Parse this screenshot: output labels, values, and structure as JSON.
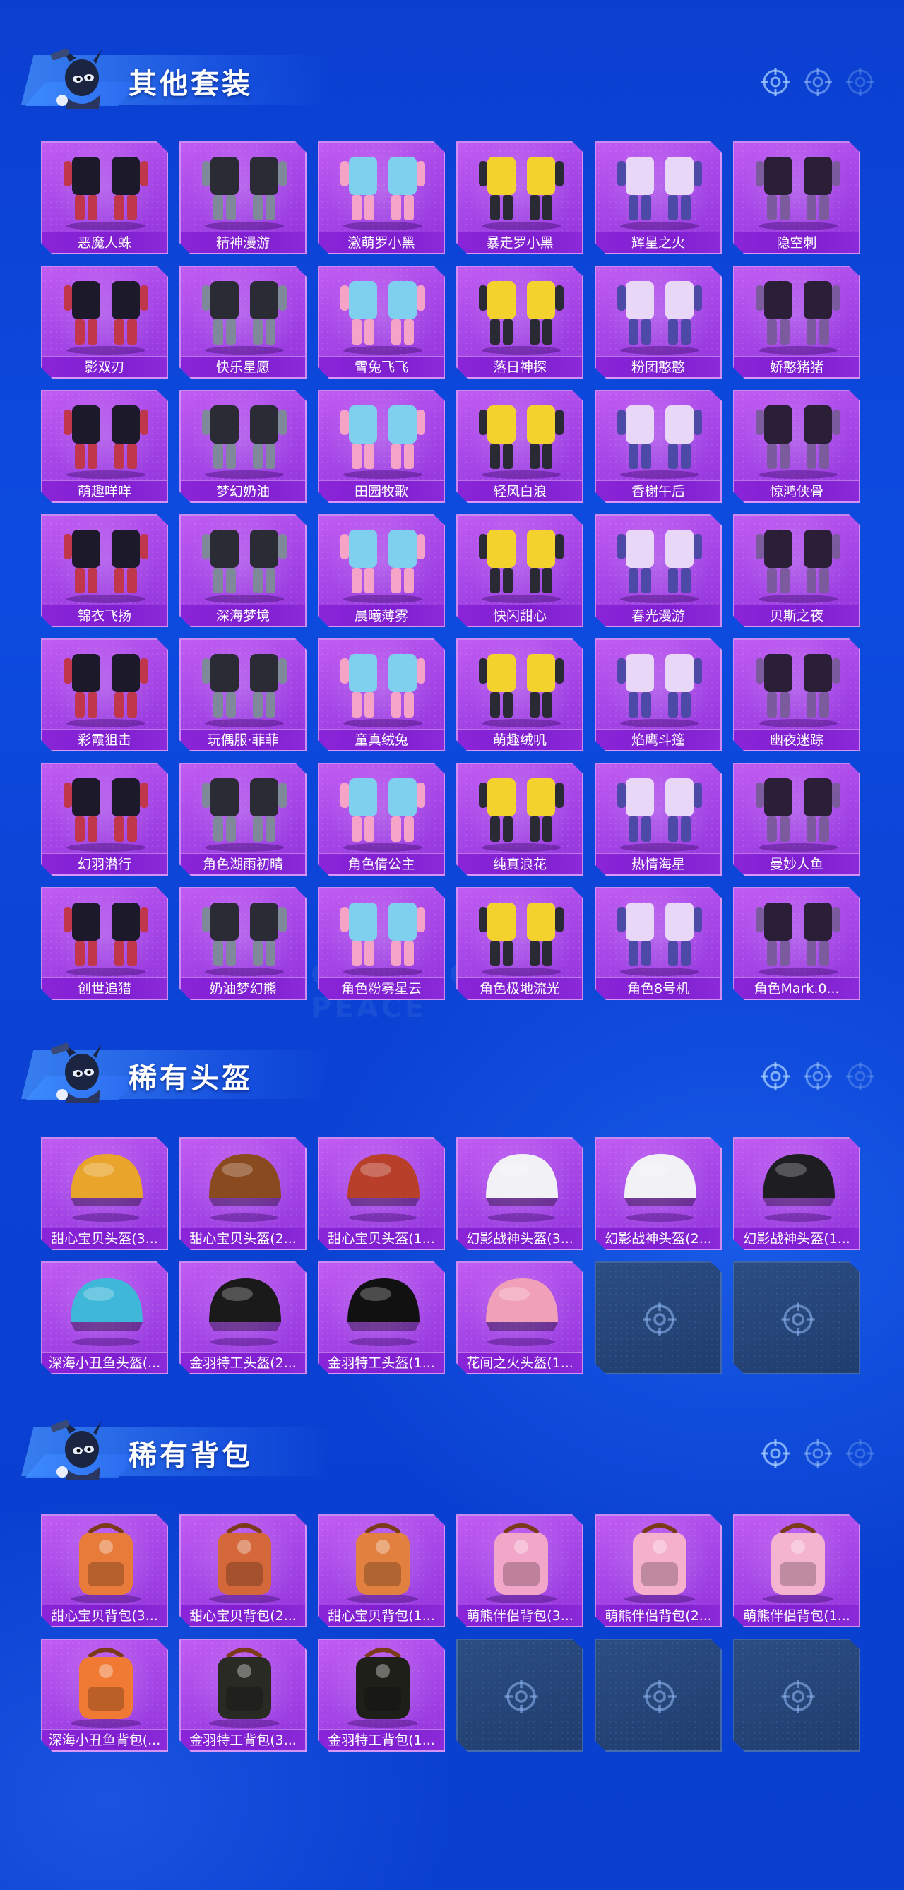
{
  "page": {
    "watermark": "GAME FOR PEACE"
  },
  "colors": {
    "background": "#0d4be0",
    "card_purple": "#a747e8",
    "label_bar": "#8a24d8",
    "empty_slot": "#2b4d82"
  },
  "sections": [
    {
      "title": "其他套装",
      "icon": "target-icon",
      "items": [
        "恶魔人蛛",
        "精神漫游",
        "激萌罗小黑",
        "暴走罗小黑",
        "辉星之火",
        "隐空刺",
        "影双刃",
        "快乐星愿",
        "雪兔飞飞",
        "落日神探",
        "粉团憨憨",
        "娇憨猪猪",
        "萌趣咩咩",
        "梦幻奶油",
        "田园牧歌",
        "轻风白浪",
        "香榭午后",
        "惊鸿侠骨",
        "锦衣飞扬",
        "深海梦境",
        "晨曦薄雾",
        "快闪甜心",
        "春光漫游",
        "贝斯之夜",
        "彩霞狙击",
        "玩偶服·菲菲",
        "童真绒兔",
        "萌趣绒叽",
        "焰鹰斗篷",
        "幽夜迷踪",
        "幻羽潜行",
        "角色湖雨初晴",
        "角色倩公主",
        "纯真浪花",
        "热情海星",
        "曼妙人鱼",
        "创世追猎",
        "奶油梦幻熊",
        "角色粉雾星云",
        "角色极地流光",
        "角色8号机",
        "角色Mark.0..."
      ],
      "empty_slots": 0
    },
    {
      "title": "稀有头盔",
      "icon": "target-icon",
      "items": [
        "甜心宝贝头盔(3...",
        "甜心宝贝头盔(2...",
        "甜心宝贝头盔(1...",
        "幻影战神头盔(3...",
        "幻影战神头盔(2...",
        "幻影战神头盔(1...",
        "深海小丑鱼头盔(...",
        "金羽特工头盔(2...",
        "金羽特工头盔(1...",
        "花间之火头盔(1..."
      ],
      "empty_slots": 2
    },
    {
      "title": "稀有背包",
      "icon": "target-icon",
      "items": [
        "甜心宝贝背包(3...",
        "甜心宝贝背包(2...",
        "甜心宝贝背包(1...",
        "萌熊伴侣背包(3...",
        "萌熊伴侣背包(2...",
        "萌熊伴侣背包(1...",
        "深海小丑鱼背包(...",
        "金羽特工背包(3...",
        "金羽特工背包(1..."
      ],
      "empty_slots": 3
    }
  ]
}
